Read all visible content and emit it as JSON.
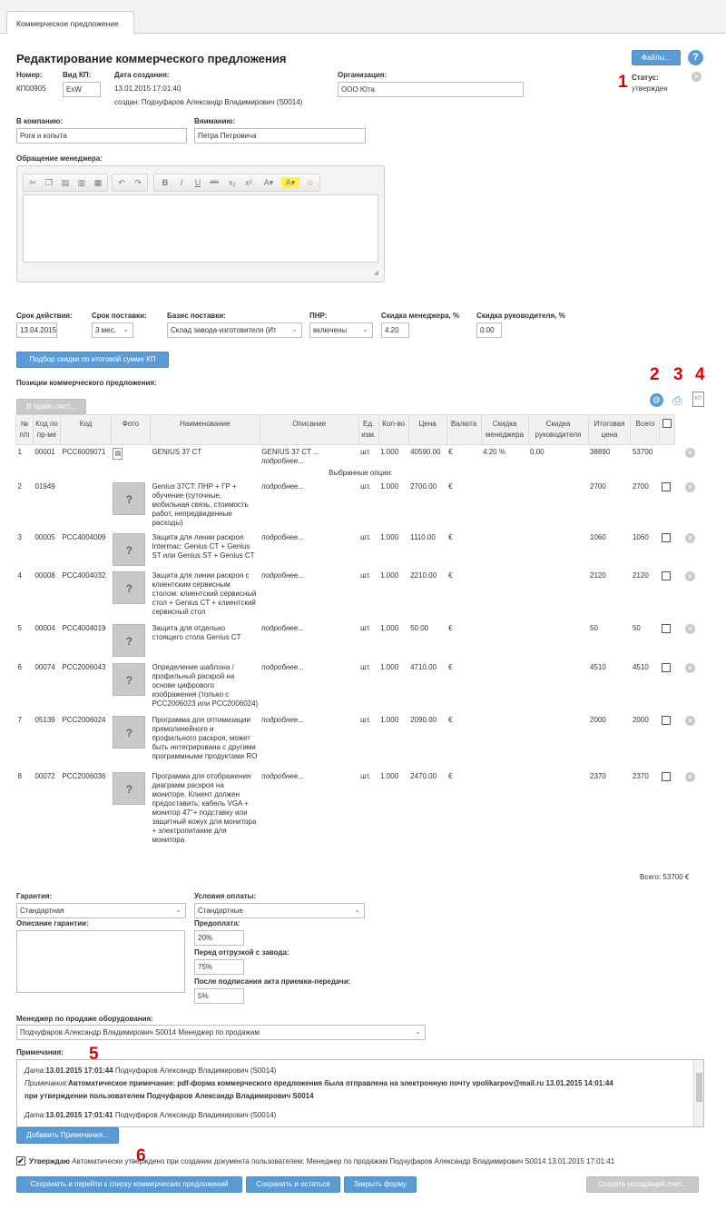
{
  "tab": "Коммерческое предложение",
  "page_title": "Редактирование коммерческого предложения",
  "files_button": "Файлы...",
  "help_icon": "?",
  "markers": [
    "1",
    "2",
    "3",
    "4",
    "5",
    "6"
  ],
  "header": {
    "number_label": "Номер:",
    "number_value": "КП00905",
    "type_label": "Вид КП:",
    "type_value": "ExW",
    "date_label": "Дата создания:",
    "date_value": "13.01.2015 17:01:40",
    "created_by": "создан: Подчуфаров Александр Владимирович (S0014)",
    "org_label": "Организация:",
    "org_value": "ООО Юта",
    "status_label": "Статус:",
    "status_value": "утвержден"
  },
  "company_label": "В компанию:",
  "company_value": "Рога и копыта",
  "attention_label": "Вниманию:",
  "attention_value": "Петра Петровича",
  "appeal_label": "Обращение менеджера:",
  "terms": {
    "validity_label": "Срок действия:",
    "validity_value": "13.04.2015",
    "delivery_label": "Срок поставки:",
    "delivery_value": "3 мес.",
    "basis_label": "Базис поставки:",
    "basis_value": "Склад завода-изготовителя (Ит",
    "pnr_label": "ПНР:",
    "pnr_value": "включены",
    "mgr_discount_label": "Скидка менеджера, %",
    "mgr_discount_value": "4.20",
    "head_discount_label": "Скидка руководителя, %",
    "head_discount_value": "0.00"
  },
  "discount_button": "Подбор скидки по итоговой сумме КП",
  "positions_label": "Позиции коммерческого предложения:",
  "pricelist_button": "В прайс-лист...",
  "table": {
    "headers": [
      "№ п/п",
      "Код по пр-ме",
      "Код",
      "Фото",
      "Наименование",
      "Описание",
      "Ед. изм.",
      "Кол-во",
      "Цена",
      "Валюта",
      "Скидка менеджера",
      "Скидка руководителя",
      "Итоговая цена",
      "Всего"
    ],
    "selected_options": "Выбранные опции:",
    "more": "подробнее...",
    "rows": [
      {
        "n": "1",
        "code1": "00001",
        "code2": "PCC6009071",
        "name": "GENIUS 37 CT",
        "desc": "GENIUS 37 CT ...",
        "unit": "шт.",
        "qty": "1.000",
        "price": "40590.00",
        "cur": "€",
        "mgr": "4.20",
        "pct": "%",
        "head": "0.00",
        "final": "38890",
        "total": "53700"
      },
      {
        "n": "2",
        "code1": "01949",
        "code2": "",
        "name": "Genius 37CT: ПНР + ГР + обучение (суточные, мобильная связь, стоимость работ, непредвиденные расходы)",
        "unit": "шт.",
        "qty": "1.000",
        "price": "2700.00",
        "cur": "€",
        "final": "2700",
        "total": "2700"
      },
      {
        "n": "3",
        "code1": "00005",
        "code2": "PCC4004009",
        "name": "Защита для линии раскроя Intermac: Genius CT + Genius ST или Genius ST + Genius CT",
        "unit": "шт.",
        "qty": "1.000",
        "price": "1110.00",
        "cur": "€",
        "final": "1060",
        "total": "1060"
      },
      {
        "n": "4",
        "code1": "00008",
        "code2": "PCC4004032",
        "name": "Защита для линии раскроя с клиентским сервисным столом: клиентский сервисный стол + Genius CT + клиентский сервисный стол",
        "unit": "шт.",
        "qty": "1.000",
        "price": "2210.00",
        "cur": "€",
        "final": "2120",
        "total": "2120"
      },
      {
        "n": "5",
        "code1": "00004",
        "code2": "PCC4004019",
        "name": "Защита для отдельно стоящего стола Genius CT",
        "unit": "шт.",
        "qty": "1.000",
        "price": "50.00",
        "cur": "€",
        "final": "50",
        "total": "50"
      },
      {
        "n": "6",
        "code1": "00074",
        "code2": "PCC2006043",
        "name": "Определение шаблона / профильный раскрой на основе цифрового изображения (только с PCC2006023 или PCC2006024)",
        "unit": "шт.",
        "qty": "1.000",
        "price": "4710.00",
        "cur": "€",
        "final": "4510",
        "total": "4510"
      },
      {
        "n": "7",
        "code1": "05139",
        "code2": "PCC2006024",
        "name": "Программа для оптимизации прямолинейного и профильного раскроя, может быть интегрирована с другими программными продуктами RO",
        "unit": "шт.",
        "qty": "1.000",
        "price": "2090.00",
        "cur": "€",
        "final": "2000",
        "total": "2000"
      },
      {
        "n": "8",
        "code1": "00072",
        "code2": "PCC2006036",
        "name": "Программа для отображения диаграмм раскроя на мониторе. Клиент должен предоставить: кабель VGA + монитор 47\"+ подставку или защитный кожух для монитора + электропитание для монитора",
        "unit": "шт.",
        "qty": "1.000",
        "price": "2470.00",
        "cur": "€",
        "final": "2370",
        "total": "2370"
      }
    ],
    "grand_total": "Всего: 53700 €"
  },
  "warranty_label": "Гарантия:",
  "warranty_value": "Стандартная",
  "warranty_desc_label": "Описание гарантии:",
  "payment_label": "Условия оплаты:",
  "payment_value": "Стандартные",
  "prepay_label": "Предоплата:",
  "prepay_value": "20%",
  "before_ship_label": "Перед отгрузкой с завода:",
  "before_ship_value": "75%",
  "after_act_label": "После подписания акта приемки-передачи:",
  "after_act_value": "5%",
  "manager_label": "Менеджер по продаже оборудования:",
  "manager_value": "Подчуфаров Александр Владимирович S0014 Менеджер по продажам",
  "notes_label": "Примечания:",
  "notes": [
    {
      "date_label": "Дата:",
      "date": "13.01.2015 17:01:44",
      "author": "Подчуфаров Александр Владимирович (S0014)"
    },
    {
      "note_label": "Примечания:",
      "text1": "Автоматическое примечание: pdf-форма коммерческого предложения была отправлена на электронную почту vpolikarpov@mail.ru 13.01.2015 14:01:44",
      "text2": "при утверждении пользователем Подчуфаров Александр Владимирович S0014"
    },
    {
      "date_label": "Дата:",
      "date": "13.01.2015 17:01:41",
      "author": "Подчуфаров Александр Владимирович (S0014)"
    }
  ],
  "add_notes_button": "Добавить Примечания...",
  "approve_label": "Утверждаю",
  "approve_text": "Автоматически утверждено при создании документа пользователем: Менеджер по продажам Подчуфаров Александр Владимирович S0014 13.01.2015 17:01:41",
  "buttons": {
    "save_list": "Сохранить и перейти к списку коммерческих предложений",
    "save_stay": "Сохранить и остаться",
    "close": "Закрыть форму",
    "invoice": "Создать исходящий счет..."
  },
  "colors": {
    "accent": "#5b9bd5",
    "marker": "#e00000"
  }
}
